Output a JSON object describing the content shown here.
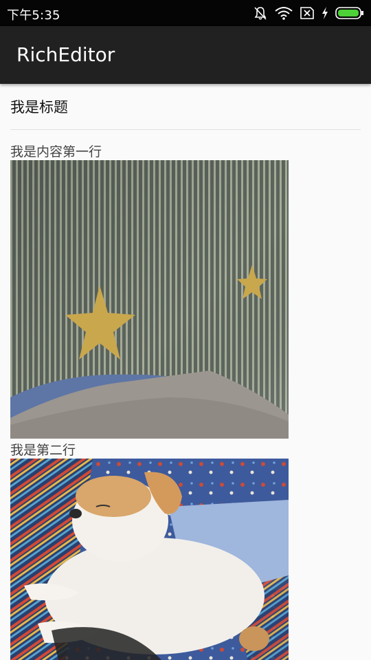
{
  "status_bar": {
    "time": "下午5:35",
    "icons": [
      "bell-muted-icon",
      "wifi-icon",
      "no-sim-icon",
      "charging-icon",
      "battery-icon"
    ],
    "battery_color": "#4cd137"
  },
  "app_bar": {
    "title": "RichEditor",
    "background": "#212121"
  },
  "editor": {
    "title": "我是标题",
    "content": [
      {
        "type": "text",
        "text": "我是内容第一行"
      },
      {
        "type": "image",
        "description": "striped-fabric-with-stars-photo"
      },
      {
        "type": "text",
        "text": "我是第二行"
      },
      {
        "type": "image",
        "description": "sleeping-puppy-photo"
      }
    ]
  }
}
